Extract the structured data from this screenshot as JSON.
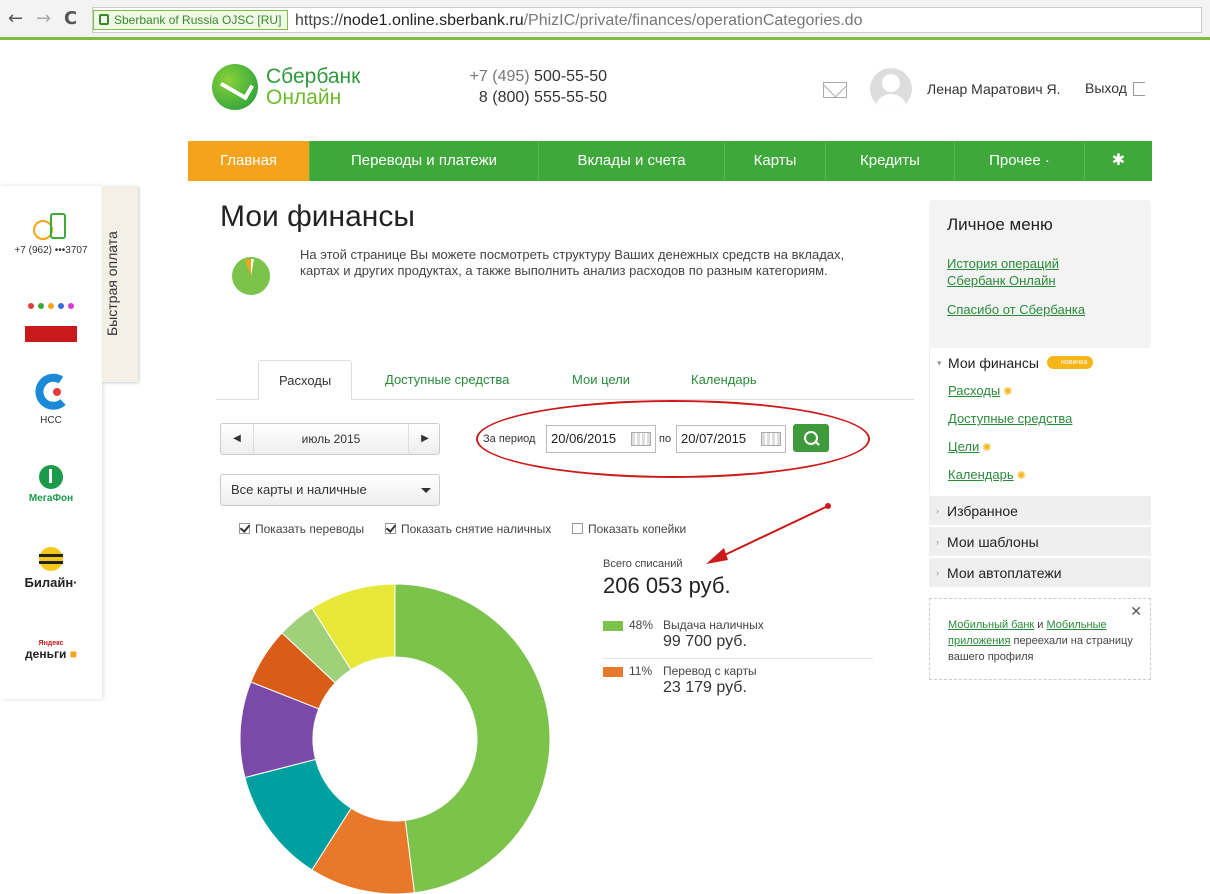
{
  "browser": {
    "back_glyph": "←",
    "forward_glyph": "→",
    "reload_glyph": "C",
    "secure_label": "Sberbank of Russia OJSC [RU]",
    "url_scheme": "https://",
    "url_host": "node1.online.sberbank.ru",
    "url_path": "/PhizIC/private/finances/operationCategories.do"
  },
  "header": {
    "logo_line1": "Сбербанк",
    "logo_line2": "Онлайн",
    "phone1_prefix": "+7 (495)",
    "phone1_number": "500-55-50",
    "phone2_prefix": "8 (800)",
    "phone2_number": "555-55-50",
    "user_name": "Ленар Маратович Я.",
    "logout_label": "Выход"
  },
  "nav": {
    "items": [
      {
        "label": "Главная",
        "active": true
      },
      {
        "label": "Переводы и платежи"
      },
      {
        "label": "Вклады и счета"
      },
      {
        "label": "Карты"
      },
      {
        "label": "Кредиты"
      },
      {
        "label": "Прочее ·"
      }
    ],
    "settings_glyph": "✱"
  },
  "quick_pay": {
    "label": "Быстрая оплата",
    "phone": "+7 (962) •••3707",
    "items": [
      "НСС",
      "МегаФон",
      "Билайн·",
      "Яндекс",
      "деньги"
    ]
  },
  "page": {
    "title": "Мои финансы",
    "description": "На этой странице Вы можете посмотреть структуру Ваших денежных средств на вкладах, картах и других продуктах, а также выполнить анализ расходов по разным категориям."
  },
  "tabs": [
    "Расходы",
    "Доступные средства",
    "Мои цели",
    "Календарь"
  ],
  "filters": {
    "month": "июль 2015",
    "prev_glyph": "◀",
    "next_glyph": "▶",
    "period_label": "За период",
    "date_from": "20/06/2015",
    "to_label": "по",
    "date_to": "20/07/2015",
    "cards_select": "Все карты и наличные",
    "show_transfers": "Показать переводы",
    "show_cash": "Показать снятие наличных",
    "show_kopecks": "Показать копейки",
    "show_transfers_checked": true,
    "show_cash_checked": true,
    "show_kopecks_checked": false
  },
  "summary": {
    "total_label": "Всего списаний",
    "total_value": "206 053 руб.",
    "rows": [
      {
        "pct": "48%",
        "name": "Выдача наличных",
        "amount": "99 700 руб.",
        "color": "#7bc34a"
      },
      {
        "pct": "11%",
        "name": "Перевод с карты",
        "amount": "23 179 руб.",
        "color": "#e8792a"
      }
    ]
  },
  "chart_data": {
    "type": "pie",
    "slices": [
      {
        "label": "Выдача наличных",
        "value": 48,
        "color": "#7bc34a"
      },
      {
        "label": "Перевод с карты",
        "value": 11,
        "color": "#e8792a"
      },
      {
        "label": "",
        "value": 12,
        "color": "#00a0a0"
      },
      {
        "label": "",
        "value": 10,
        "color": "#7b4aa8"
      },
      {
        "label": "",
        "value": 6,
        "color": "#d95d17"
      },
      {
        "label": "",
        "value": 4,
        "color": "#9fd07a"
      },
      {
        "label": "",
        "value": 9,
        "color": "#e8e83a"
      }
    ]
  },
  "right_menu": {
    "title": "Личное меню",
    "history_link": "История операций Сбербанк Онлайн",
    "spasibo_link": "Спасибо от Сбербанка",
    "finances_head": "Мои финансы",
    "new_badge": "новинка",
    "sub_links": [
      "Расходы",
      "Доступные средства",
      "Цели",
      "Календарь"
    ],
    "favorites": "Избранное",
    "templates": "Мои шаблоны",
    "autopay": "Мои автоплатежи",
    "notice_pre": "Мобильный банк",
    "notice_and": "и",
    "notice_link2": "Мобильные приложения",
    "notice_post": "переехали на страницу вашего профиля",
    "close_glyph": "✕"
  },
  "colors": {
    "brand_green": "#3ea83a",
    "active_tab": "#f5a31a",
    "annotation_red": "#cc1a1a"
  }
}
